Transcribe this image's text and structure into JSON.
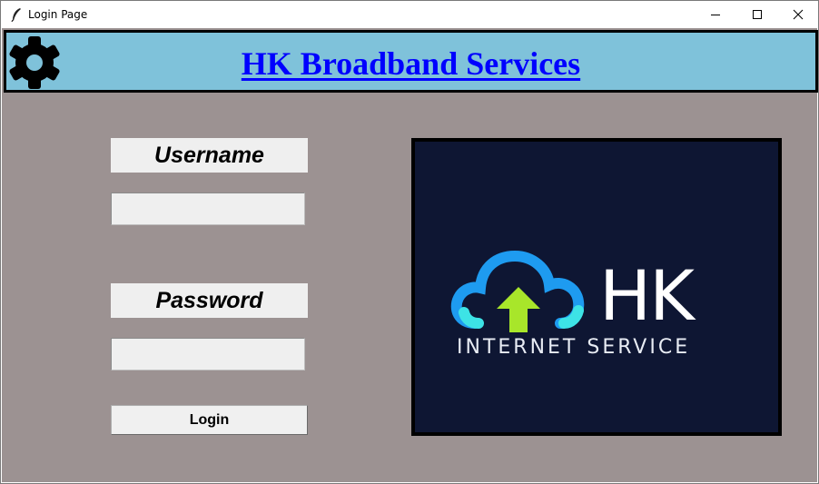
{
  "window": {
    "title": "Login Page",
    "controls": {
      "minimize_icon": "minimize-icon",
      "maximize_icon": "maximize-icon",
      "close_icon": "close-icon"
    }
  },
  "header": {
    "title": "HK Broadband Services",
    "settings_icon": "gear-icon",
    "background": "#7fc2da",
    "title_color": "#0000ff"
  },
  "form": {
    "username_label": "Username",
    "username_value": "",
    "password_label": "Password",
    "password_value": "",
    "login_label": "Login"
  },
  "logo": {
    "brand": "HK",
    "tagline": "INTERNET SERVICE",
    "background": "#0e1633",
    "cloud_color": "#1e9bf0",
    "cloud_accent": "#3de3e6",
    "arrow_color": "#a8e62a"
  },
  "colors": {
    "content_background": "#9c9292",
    "field_background": "#efefef"
  }
}
